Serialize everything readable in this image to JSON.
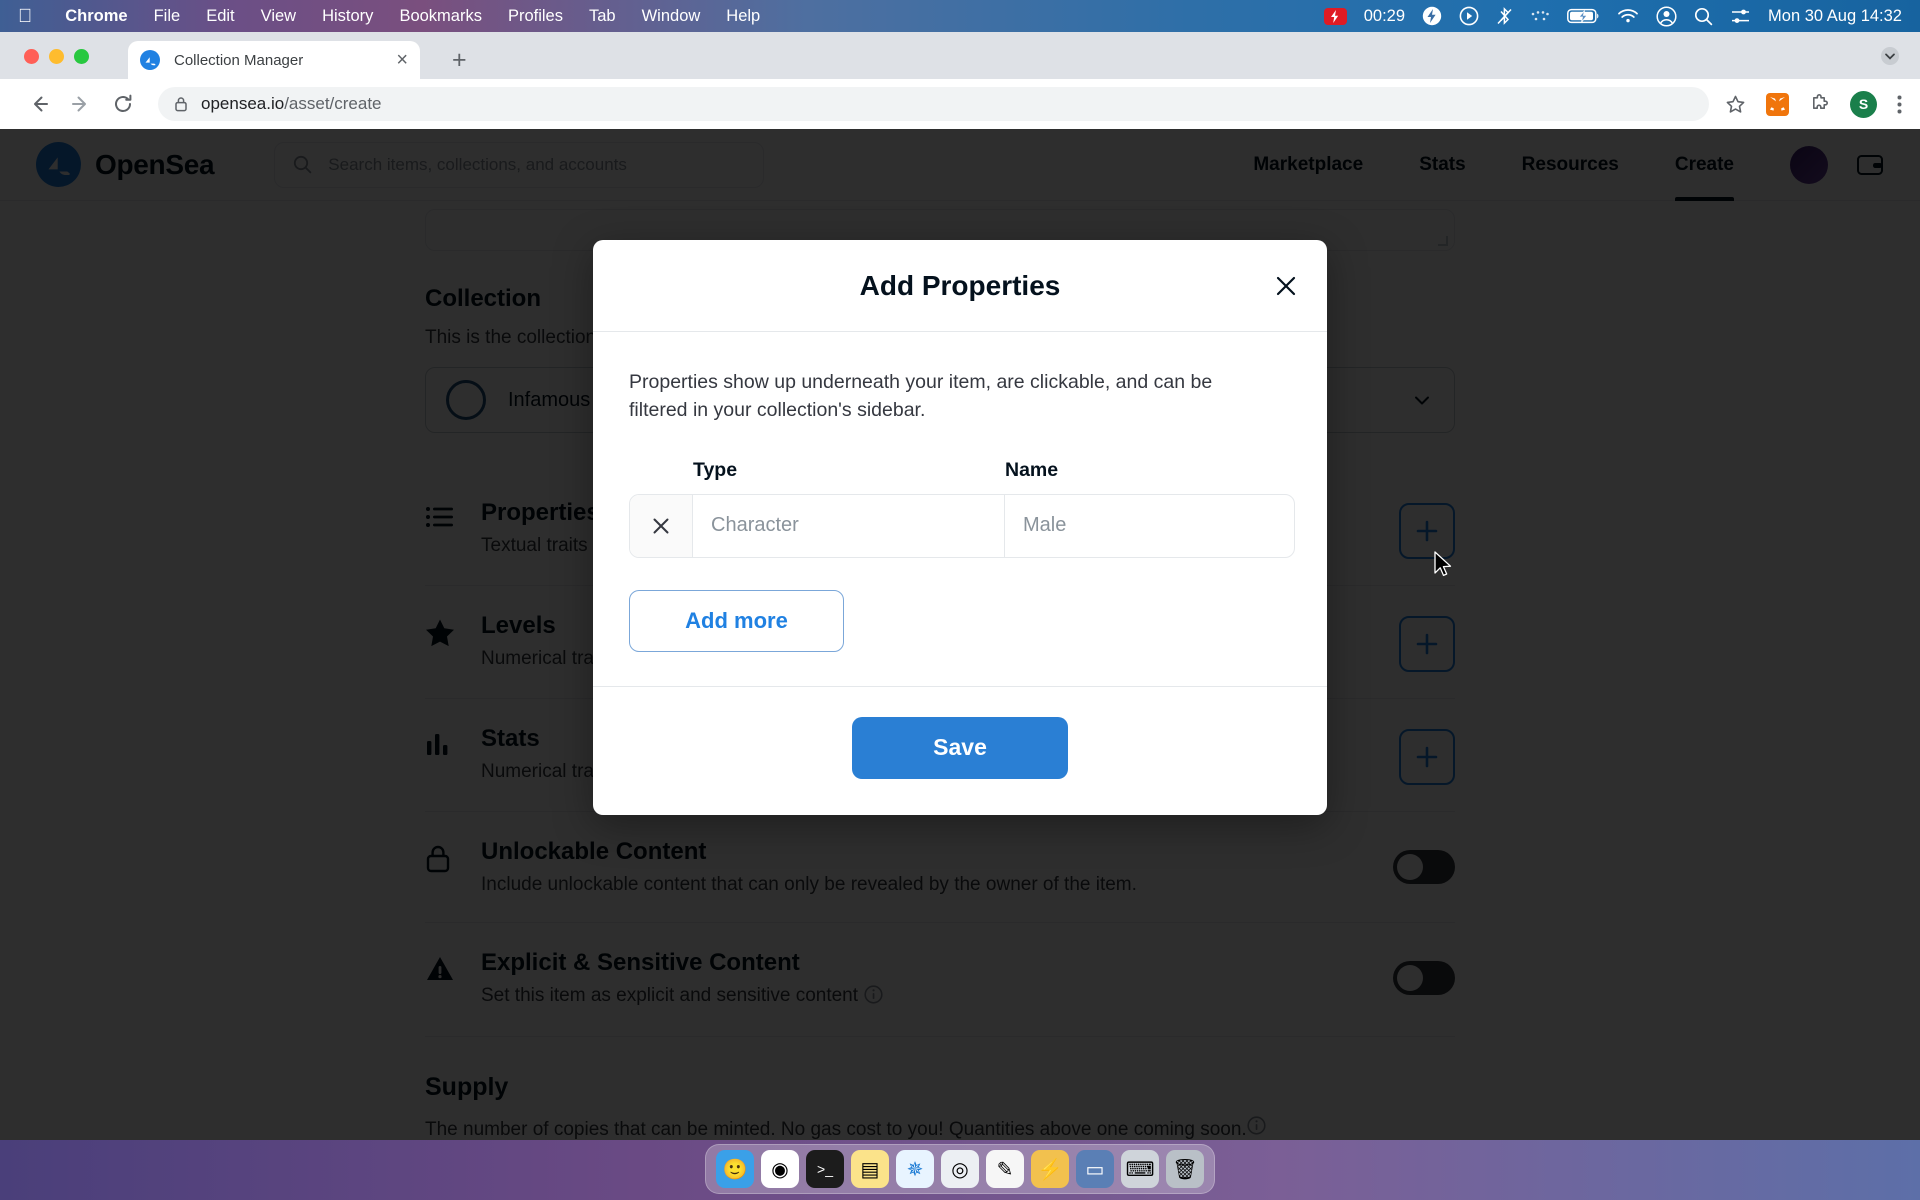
{
  "menubar": {
    "apple": "apple-logo",
    "items": [
      {
        "label": "Chrome",
        "bold": true
      },
      {
        "label": "File",
        "bold": false
      },
      {
        "label": "Edit",
        "bold": false
      },
      {
        "label": "View",
        "bold": false
      },
      {
        "label": "History",
        "bold": false
      },
      {
        "label": "Bookmarks",
        "bold": false
      },
      {
        "label": "Profiles",
        "bold": false
      },
      {
        "label": "Tab",
        "bold": false
      },
      {
        "label": "Window",
        "bold": false
      },
      {
        "label": "Help",
        "bold": false
      }
    ],
    "recording_time": "00:29",
    "clock": "Mon 30 Aug  14:32",
    "status_icons": [
      "screen-recording-icon",
      "bolt-icon",
      "play-circle-icon",
      "bluetooth-off-icon",
      "dots-icon",
      "battery-charging-icon",
      "wifi-icon",
      "user-circle-icon",
      "search-icon",
      "control-center-icon"
    ]
  },
  "browser": {
    "tab_title": "Collection Manager",
    "tab_favicon": "opensea-favicon",
    "new_tab_label": "+",
    "close_tab_label": "×",
    "url_host": "opensea.io",
    "url_path": "/asset/create",
    "back_label": "back-arrow",
    "forward_label": "forward-arrow",
    "reload_label": "reload",
    "star_label": "bookmark-star",
    "profile_initial": "S"
  },
  "opensea": {
    "brand": "OpenSea",
    "search_placeholder": "Search items, collections, and accounts",
    "nav_links": [
      {
        "label": "Marketplace",
        "active": false
      },
      {
        "label": "Stats",
        "active": false
      },
      {
        "label": "Resources",
        "active": false
      },
      {
        "label": "Create",
        "active": true
      }
    ],
    "collection": {
      "heading": "Collection",
      "subtext": "This is the collection where your item will appear.",
      "selected": "Infamous"
    },
    "rows": [
      {
        "icon": "list-icon",
        "name": "Properties",
        "desc": "Textual traits that show up as rectangles",
        "control": "plus"
      },
      {
        "icon": "star-icon",
        "name": "Levels",
        "desc": "Numerical traits that show as a progress bar",
        "control": "plus"
      },
      {
        "icon": "bar-chart-icon",
        "name": "Stats",
        "desc": "Numerical traits that just show as numbers",
        "control": "plus"
      },
      {
        "icon": "lock-icon",
        "name": "Unlockable Content",
        "desc": "Include unlockable content that can only be revealed by the owner of the item.",
        "control": "toggle"
      },
      {
        "icon": "warning-icon",
        "name": "Explicit & Sensitive Content",
        "desc": "Set this item as explicit and sensitive content",
        "control": "toggle",
        "info": true
      }
    ],
    "supply": {
      "title": "Supply",
      "desc": "The number of copies that can be minted. No gas cost to you! Quantities above one coming soon.",
      "info": true
    }
  },
  "modal": {
    "title": "Add Properties",
    "close_label": "close-icon",
    "description": "Properties show up underneath your item, are clickable, and can be filtered in your collection's sidebar.",
    "col_type_label": "Type",
    "col_name_label": "Name",
    "remove_label": "remove-row-icon",
    "type_placeholder": "Character",
    "name_placeholder": "Male",
    "type_value": "",
    "name_value": "",
    "add_more_label": "Add more",
    "save_label": "Save"
  },
  "colors": {
    "accent_blue": "#2081e2",
    "save_blue": "#2a7fd4",
    "dark_text": "#04111d",
    "muted_text": "#8a939b"
  },
  "dock": {
    "items": [
      {
        "name": "finder-icon",
        "glyph": "🙂",
        "bg": "#3aa0e8"
      },
      {
        "name": "chrome-icon",
        "glyph": "◉",
        "bg": "#ffffff"
      },
      {
        "name": "terminal-icon",
        "glyph": ">_",
        "bg": "#1c1c1c"
      },
      {
        "name": "notes-icon",
        "glyph": "▤",
        "bg": "#fbe38a"
      },
      {
        "name": "safari-icon",
        "glyph": "✵",
        "bg": "#e8f4ff"
      },
      {
        "name": "preview-icon",
        "glyph": "◎",
        "bg": "#eceff3"
      },
      {
        "name": "pencil-icon",
        "glyph": "✎",
        "bg": "#f6f6f6"
      },
      {
        "name": "vscode-icon",
        "glyph": "⚡",
        "bg": "#f2c14e"
      },
      {
        "name": "display-icon",
        "glyph": "▭",
        "bg": "#5a7fb5"
      },
      {
        "name": "keyboard-icon",
        "glyph": "⌨",
        "bg": "#cfd4da"
      },
      {
        "name": "trash-icon",
        "glyph": "🗑",
        "bg": "#b9c0c7"
      }
    ]
  }
}
